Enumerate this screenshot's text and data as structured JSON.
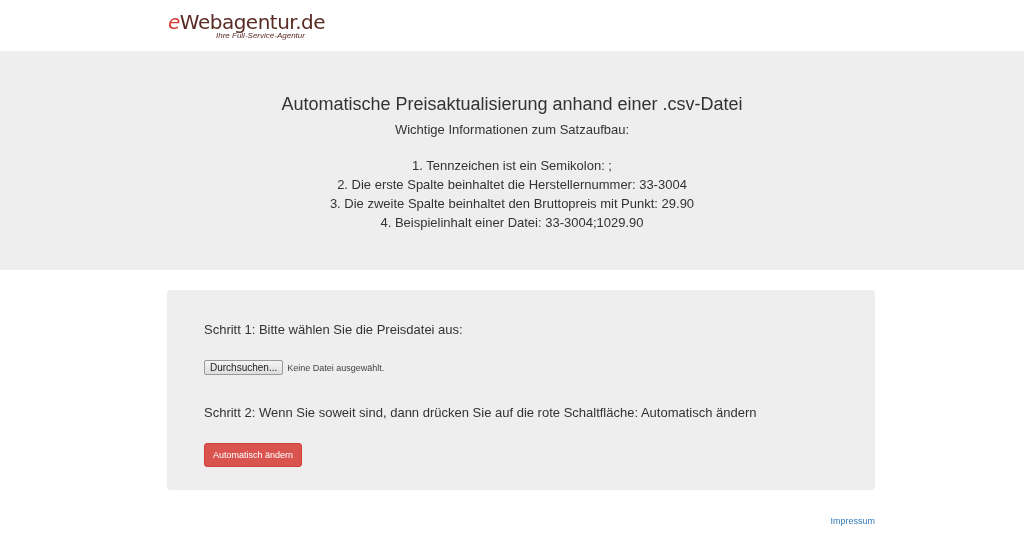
{
  "logo": {
    "first_letter": "e",
    "rest": "Webagentur.de",
    "tagline": "Ihre Full-Service-Agentur"
  },
  "hero": {
    "title": "Automatische Preisaktualisierung anhand einer .csv-Datei",
    "subtitle": "Wichtige Informationen zum Satzaufbau:",
    "items": [
      "1. Tennzeichen ist ein Semikolon: ;",
      "2. Die erste Spalte beinhaltet die Herstellernummer: 33-3004",
      "3. Die zweite Spalte beinhaltet den Bruttopreis mit Punkt: 29.90",
      "4. Beispielinhalt einer Datei: 33-3004;1029.90"
    ]
  },
  "form": {
    "step1": "Schritt 1: Bitte wählen Sie die Preisdatei aus:",
    "browse_button": "Durchsuchen...",
    "file_status": "Keine Datei ausgewählt.",
    "step2": "Schritt 2: Wenn Sie soweit sind, dann drücken Sie auf die rote Schaltfläche: Automatisch ändern",
    "submit_button": "Automatisch ändern"
  },
  "footer": {
    "link": "Impressum"
  }
}
